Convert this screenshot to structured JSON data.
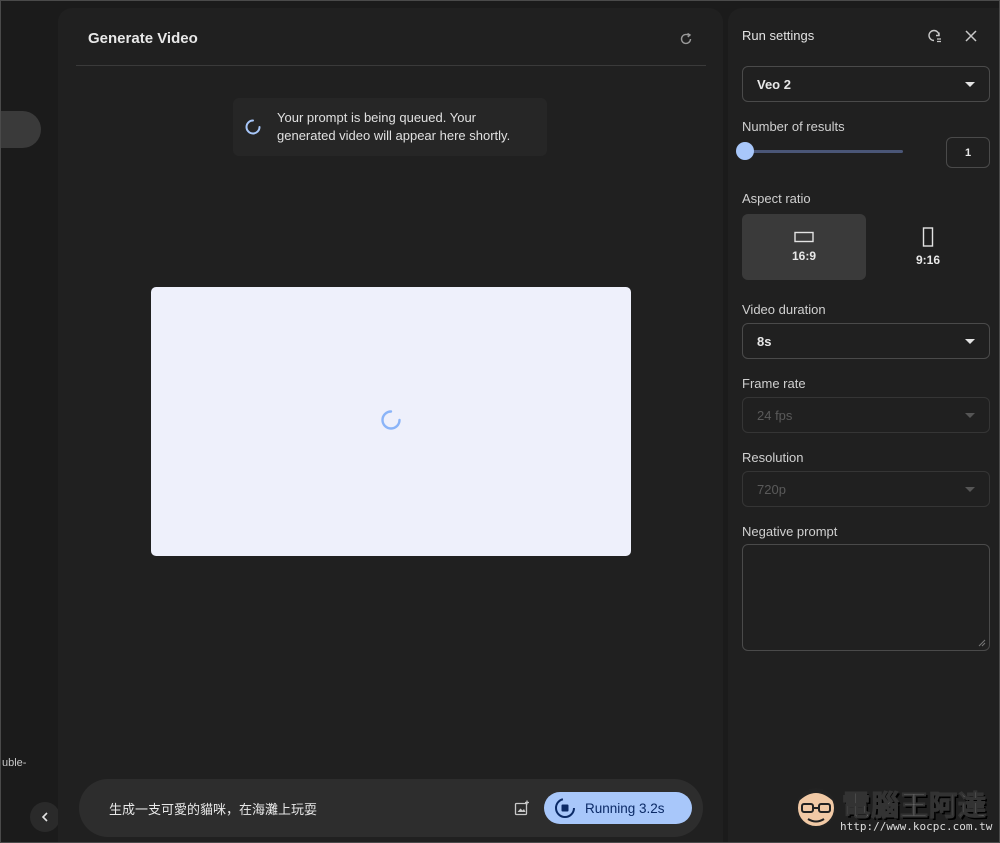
{
  "left_rail": {
    "truncated_text": "uble-"
  },
  "main": {
    "title": "Generate Video",
    "toast_text": "Your prompt is being queued. Your generated video will appear here shortly.",
    "prompt_text": "生成一支可愛的貓咪，在海灘上玩耍",
    "run_label": "Running 3.2s"
  },
  "settings": {
    "title": "Run settings",
    "model": "Veo 2",
    "num_results_label": "Number of results",
    "num_results_value": "1",
    "aspect_label": "Aspect ratio",
    "aspects": [
      {
        "label": "16:9",
        "selected": true
      },
      {
        "label": "9:16",
        "selected": false
      }
    ],
    "duration_label": "Video duration",
    "duration_value": "8s",
    "frame_rate_label": "Frame rate",
    "frame_rate_value": "24 fps",
    "resolution_label": "Resolution",
    "resolution_value": "720p",
    "negative_prompt_label": "Negative prompt",
    "negative_prompt_value": ""
  },
  "watermark": {
    "title": "電腦王阿達",
    "url": "http://www.kocpc.com.tw"
  },
  "colors": {
    "accent": "#a8c7fa",
    "panel": "#202020",
    "background": "#1b1b1b",
    "preview": "#eef0fb"
  },
  "icons": [
    "refresh-icon",
    "spinner-icon",
    "add-media-icon",
    "stop-icon",
    "reset-icon",
    "close-icon",
    "chevron-left-icon",
    "landscape-icon",
    "portrait-icon",
    "dropdown-caret-icon"
  ]
}
